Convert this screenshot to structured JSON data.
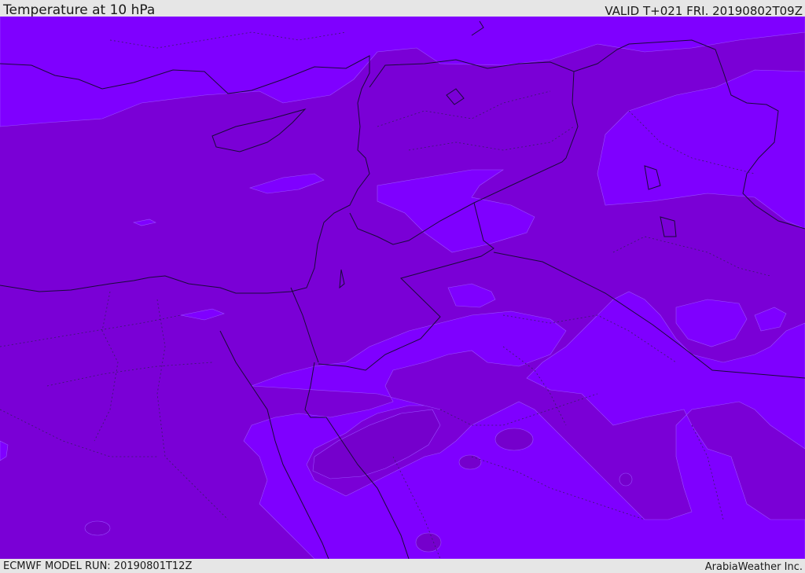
{
  "header": {
    "title": "Temperature at 10 hPa",
    "valid": "VALID T+021 FRI. 20190802T09Z"
  },
  "footer": {
    "model_run": "ECMWF MODEL RUN: 20190801T12Z",
    "credit": "ArabiaWeather Inc."
  },
  "colors": {
    "background_band": "#7a00d6",
    "lighter_band": "#7f00ff",
    "border_line": "#1a0a3a"
  }
}
